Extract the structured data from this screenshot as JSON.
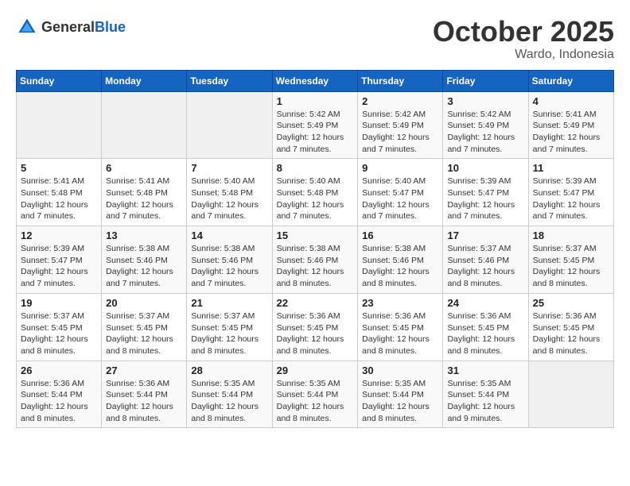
{
  "header": {
    "logo_general": "General",
    "logo_blue": "Blue",
    "month": "October 2025",
    "location": "Wardo, Indonesia"
  },
  "weekdays": [
    "Sunday",
    "Monday",
    "Tuesday",
    "Wednesday",
    "Thursday",
    "Friday",
    "Saturday"
  ],
  "weeks": [
    [
      {
        "day": "",
        "info": ""
      },
      {
        "day": "",
        "info": ""
      },
      {
        "day": "",
        "info": ""
      },
      {
        "day": "1",
        "info": "Sunrise: 5:42 AM\nSunset: 5:49 PM\nDaylight: 12 hours\nand 7 minutes."
      },
      {
        "day": "2",
        "info": "Sunrise: 5:42 AM\nSunset: 5:49 PM\nDaylight: 12 hours\nand 7 minutes."
      },
      {
        "day": "3",
        "info": "Sunrise: 5:42 AM\nSunset: 5:49 PM\nDaylight: 12 hours\nand 7 minutes."
      },
      {
        "day": "4",
        "info": "Sunrise: 5:41 AM\nSunset: 5:49 PM\nDaylight: 12 hours\nand 7 minutes."
      }
    ],
    [
      {
        "day": "5",
        "info": "Sunrise: 5:41 AM\nSunset: 5:48 PM\nDaylight: 12 hours\nand 7 minutes."
      },
      {
        "day": "6",
        "info": "Sunrise: 5:41 AM\nSunset: 5:48 PM\nDaylight: 12 hours\nand 7 minutes."
      },
      {
        "day": "7",
        "info": "Sunrise: 5:40 AM\nSunset: 5:48 PM\nDaylight: 12 hours\nand 7 minutes."
      },
      {
        "day": "8",
        "info": "Sunrise: 5:40 AM\nSunset: 5:48 PM\nDaylight: 12 hours\nand 7 minutes."
      },
      {
        "day": "9",
        "info": "Sunrise: 5:40 AM\nSunset: 5:47 PM\nDaylight: 12 hours\nand 7 minutes."
      },
      {
        "day": "10",
        "info": "Sunrise: 5:39 AM\nSunset: 5:47 PM\nDaylight: 12 hours\nand 7 minutes."
      },
      {
        "day": "11",
        "info": "Sunrise: 5:39 AM\nSunset: 5:47 PM\nDaylight: 12 hours\nand 7 minutes."
      }
    ],
    [
      {
        "day": "12",
        "info": "Sunrise: 5:39 AM\nSunset: 5:47 PM\nDaylight: 12 hours\nand 7 minutes."
      },
      {
        "day": "13",
        "info": "Sunrise: 5:38 AM\nSunset: 5:46 PM\nDaylight: 12 hours\nand 7 minutes."
      },
      {
        "day": "14",
        "info": "Sunrise: 5:38 AM\nSunset: 5:46 PM\nDaylight: 12 hours\nand 7 minutes."
      },
      {
        "day": "15",
        "info": "Sunrise: 5:38 AM\nSunset: 5:46 PM\nDaylight: 12 hours\nand 8 minutes."
      },
      {
        "day": "16",
        "info": "Sunrise: 5:38 AM\nSunset: 5:46 PM\nDaylight: 12 hours\nand 8 minutes."
      },
      {
        "day": "17",
        "info": "Sunrise: 5:37 AM\nSunset: 5:46 PM\nDaylight: 12 hours\nand 8 minutes."
      },
      {
        "day": "18",
        "info": "Sunrise: 5:37 AM\nSunset: 5:45 PM\nDaylight: 12 hours\nand 8 minutes."
      }
    ],
    [
      {
        "day": "19",
        "info": "Sunrise: 5:37 AM\nSunset: 5:45 PM\nDaylight: 12 hours\nand 8 minutes."
      },
      {
        "day": "20",
        "info": "Sunrise: 5:37 AM\nSunset: 5:45 PM\nDaylight: 12 hours\nand 8 minutes."
      },
      {
        "day": "21",
        "info": "Sunrise: 5:37 AM\nSunset: 5:45 PM\nDaylight: 12 hours\nand 8 minutes."
      },
      {
        "day": "22",
        "info": "Sunrise: 5:36 AM\nSunset: 5:45 PM\nDaylight: 12 hours\nand 8 minutes."
      },
      {
        "day": "23",
        "info": "Sunrise: 5:36 AM\nSunset: 5:45 PM\nDaylight: 12 hours\nand 8 minutes."
      },
      {
        "day": "24",
        "info": "Sunrise: 5:36 AM\nSunset: 5:45 PM\nDaylight: 12 hours\nand 8 minutes."
      },
      {
        "day": "25",
        "info": "Sunrise: 5:36 AM\nSunset: 5:45 PM\nDaylight: 12 hours\nand 8 minutes."
      }
    ],
    [
      {
        "day": "26",
        "info": "Sunrise: 5:36 AM\nSunset: 5:44 PM\nDaylight: 12 hours\nand 8 minutes."
      },
      {
        "day": "27",
        "info": "Sunrise: 5:36 AM\nSunset: 5:44 PM\nDaylight: 12 hours\nand 8 minutes."
      },
      {
        "day": "28",
        "info": "Sunrise: 5:35 AM\nSunset: 5:44 PM\nDaylight: 12 hours\nand 8 minutes."
      },
      {
        "day": "29",
        "info": "Sunrise: 5:35 AM\nSunset: 5:44 PM\nDaylight: 12 hours\nand 8 minutes."
      },
      {
        "day": "30",
        "info": "Sunrise: 5:35 AM\nSunset: 5:44 PM\nDaylight: 12 hours\nand 8 minutes."
      },
      {
        "day": "31",
        "info": "Sunrise: 5:35 AM\nSunset: 5:44 PM\nDaylight: 12 hours\nand 9 minutes."
      },
      {
        "day": "",
        "info": ""
      }
    ]
  ]
}
